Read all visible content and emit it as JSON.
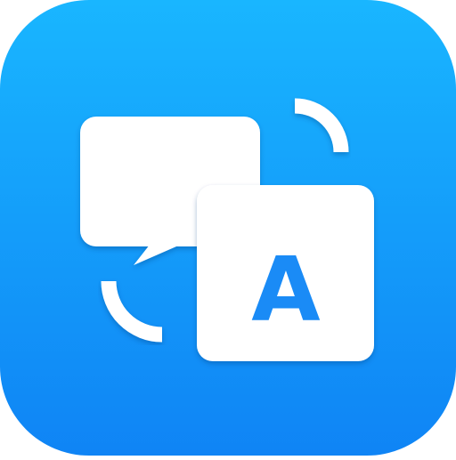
{
  "app_icon": {
    "name": "translate-app-icon",
    "icon": "translate-icon",
    "glyph_text": "A",
    "colors": {
      "gradient_top": "#19b6ff",
      "gradient_bottom": "#0f84f5",
      "foreground": "#ffffff",
      "glyph_accent": "#1a8bf6"
    }
  }
}
